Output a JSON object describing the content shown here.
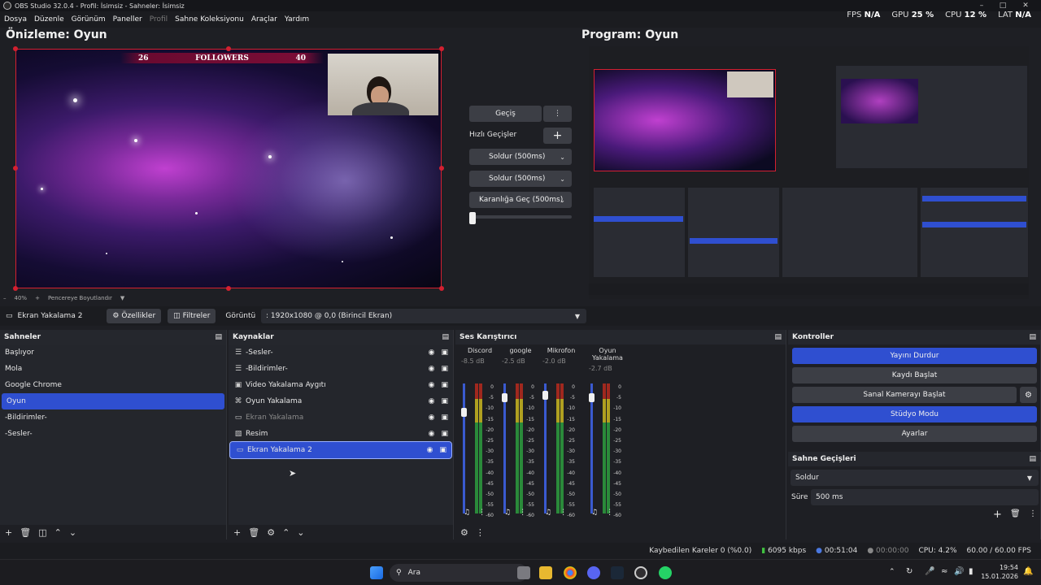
{
  "titlebar": {
    "title": "OBS Studio 32.0.4 - Profil: İsimsiz - Sahneler: İsimsiz"
  },
  "menu": [
    "Dosya",
    "Düzenle",
    "Görünüm",
    "Paneller",
    "Profil",
    "Sahne Koleksiyonu",
    "Araçlar",
    "Yardım"
  ],
  "stats": {
    "fps_label": "FPS",
    "fps_value": "N/A",
    "gpu_label": "GPU",
    "gpu_value": "25 %",
    "cpu_label": "CPU",
    "cpu_value": "12 %",
    "lat_label": "LAT",
    "lat_value": "N/A"
  },
  "preview": {
    "title": "Önizleme: Oyun",
    "followers_left": "26",
    "followers_label": "FOLLOWERS",
    "followers_right": "40",
    "zoom": "40%",
    "fit_label": "Pencereye Boyutlandır"
  },
  "program": {
    "title": "Program: Oyun"
  },
  "transitions": {
    "gecis": "Geçiş",
    "hizli": "Hızlı Geçişler",
    "q1": "Soldur (500ms)",
    "q2": "Soldur (500ms)",
    "q3": "Karanlığa Geç (500ms)"
  },
  "context": {
    "source": "Ekran Yakalama 2",
    "props": "Özellikler",
    "filters": "Filtreler",
    "display_label": "Görüntü",
    "display_value": ": 1920x1080 @ 0,0 (Birincil Ekran)"
  },
  "scenes": {
    "title": "Sahneler",
    "items": [
      "Başlıyor",
      "Mola",
      "Google Chrome",
      "Oyun",
      "-Bildirimler-",
      "-Sesler-"
    ],
    "selected": 3
  },
  "sources": {
    "title": "Kaynaklar",
    "items": [
      {
        "label": "-Sesler-",
        "icon": "list-icon",
        "dim": false
      },
      {
        "label": "-Bildirimler-",
        "icon": "list-icon",
        "dim": false
      },
      {
        "label": "Video Yakalama Aygıtı",
        "icon": "camera-icon",
        "dim": false
      },
      {
        "label": "Oyun Yakalama",
        "icon": "gamepad-icon",
        "dim": false
      },
      {
        "label": "Ekran Yakalama",
        "icon": "monitor-icon",
        "dim": true
      },
      {
        "label": "Resim",
        "icon": "image-icon",
        "dim": false
      },
      {
        "label": "Ekran Yakalama 2",
        "icon": "monitor-icon",
        "dim": false
      }
    ]
  },
  "mixer": {
    "title": "Ses Karıştırıcı",
    "channels": [
      {
        "name": "Discord",
        "db": "-8.5 dB",
        "level": 0.8
      },
      {
        "name": "google",
        "db": "-2.5 dB",
        "level": 0.92
      },
      {
        "name": "Mikrofon",
        "db": "-2.0 dB",
        "level": 0.94
      },
      {
        "name": "Oyun Yakalama",
        "db": "-2.7 dB",
        "level": 0.92
      }
    ],
    "scale": [
      "0",
      "-5",
      "-10",
      "-15",
      "-20",
      "-25",
      "-30",
      "-35",
      "-40",
      "-45",
      "-50",
      "-55",
      "-60"
    ]
  },
  "controls": {
    "title": "Kontroller",
    "stop_stream": "Yayını Durdur",
    "start_rec": "Kaydı Başlat",
    "virtual_cam": "Sanal Kamerayı Başlat",
    "studio": "Stüdyo Modu",
    "settings": "Ayarlar"
  },
  "scene_transitions": {
    "title": "Sahne Geçişleri",
    "type": "Soldur",
    "duration_label": "Süre",
    "duration": "500 ms"
  },
  "status": {
    "dropped": "Kaybedilen Kareler 0 (%0.0)",
    "bitrate": "6095 kbps",
    "live_time": "00:51:04",
    "rec_time": "00:00:00",
    "cpu": "CPU: 4.2%",
    "fps": "60.00 / 60.00 FPS"
  },
  "taskbar": {
    "search": "Ara",
    "time": "19:54",
    "date": "15.01.2026"
  },
  "colors": {
    "accent": "#2f4fd0",
    "border_red": "#d42030"
  }
}
